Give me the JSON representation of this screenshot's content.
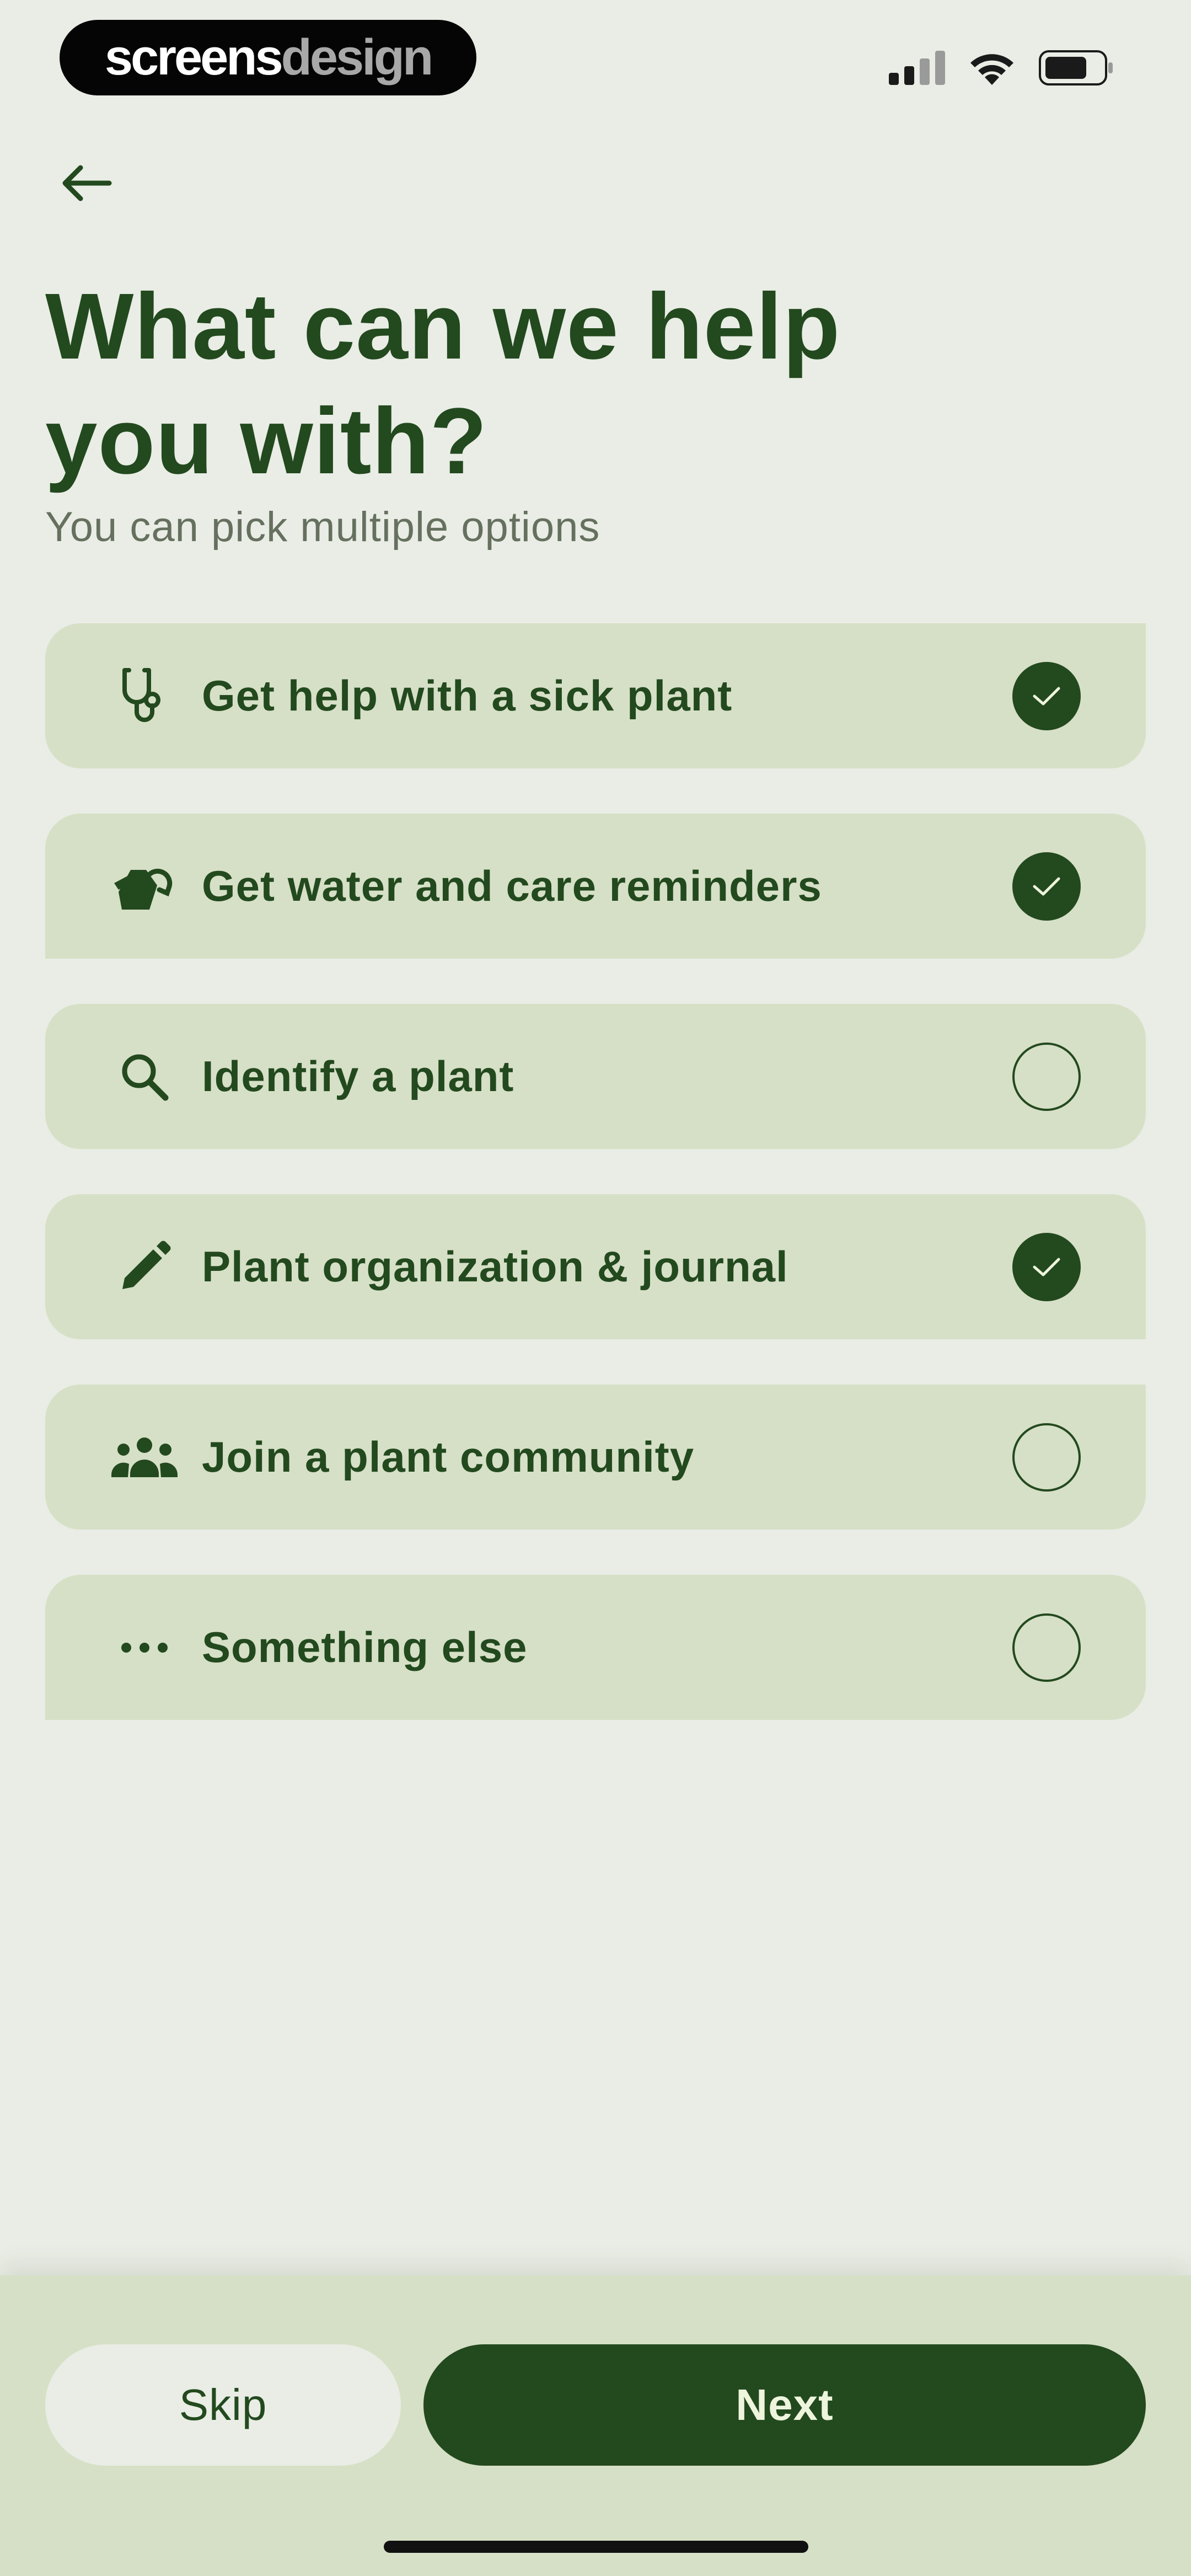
{
  "status_bar": {
    "brand_part1": "screens",
    "brand_part2": "design",
    "icons": [
      "cellular-signal-icon",
      "wifi-icon",
      "battery-icon"
    ]
  },
  "header": {
    "title": "What can we help you with?",
    "subtitle": "You can pick multiple options"
  },
  "options": [
    {
      "label": "Get help with a sick plant",
      "icon": "stethoscope-icon",
      "selected": true
    },
    {
      "label": "Get water and care reminders",
      "icon": "watering-can-icon",
      "selected": true
    },
    {
      "label": "Identify a plant",
      "icon": "search-icon",
      "selected": false
    },
    {
      "label": "Plant organization & journal",
      "icon": "pencil-icon",
      "selected": true
    },
    {
      "label": "Join a plant community",
      "icon": "people-icon",
      "selected": false
    },
    {
      "label": "Something else",
      "icon": "more-dots-icon",
      "selected": false
    }
  ],
  "footer": {
    "skip_label": "Skip",
    "next_label": "Next"
  },
  "colors": {
    "background": "#e9ede5",
    "card": "#d6e0c6",
    "primary": "#23491f",
    "subtitle": "#66705f",
    "next_text": "#eef5dc"
  }
}
